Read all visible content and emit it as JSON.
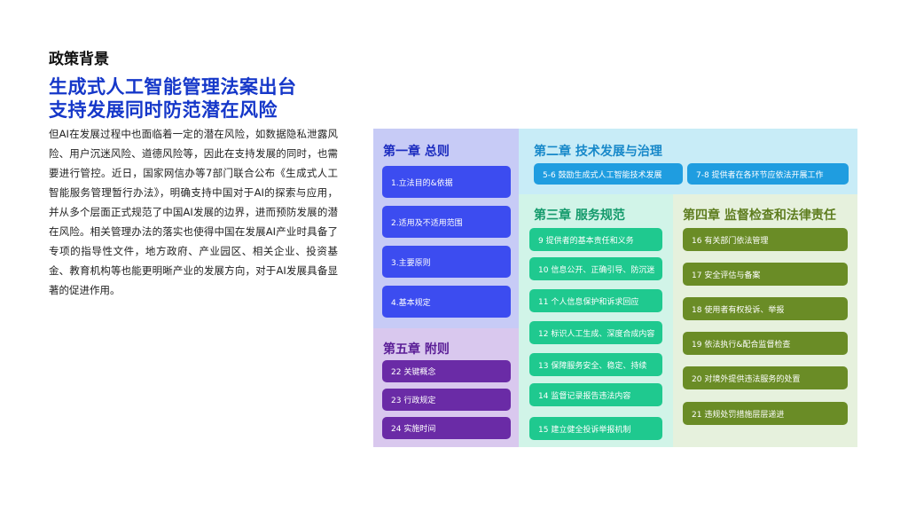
{
  "section_label": "政策背景",
  "headline": [
    "生成式人工智能管理法案出台",
    "支持发展同时防范潜在风险"
  ],
  "body": "但AI在发展过程中也面临着一定的潜在风险，如数据隐私泄露风险、用户沉迷风险、道德风险等，因此在支持发展的同时，也需要进行管控。近日，国家网信办等7部门联合公布《生成式人工智能服务管理暂行办法》，明确支持中国对于AI的探索与应用，并从多个层面正式规范了中国AI发展的边界，进而预防发展的潜在风险。相关管理办法的落实也使得中国在发展AI产业时具备了专项的指导性文件，地方政府、产业园区、相关企业、投资基金、教育机构等也能更明晰产业的发展方向，对于AI发展具备显著的促进作用。",
  "colors": {
    "headline": "#1537c9",
    "chapter1": "#3c4cf0",
    "chapter2": "#1f9de0",
    "chapter3": "#1fc98f",
    "chapter4": "#6a8c26",
    "chapter5": "#6a2ba6"
  },
  "chapters": {
    "ch1": {
      "title": "第一章 总则",
      "items": [
        "1.立法目的&依据",
        "2.适用及不适用范围",
        "3.主要原则",
        "4.基本规定"
      ]
    },
    "ch2": {
      "title": "第二章 技术发展与治理",
      "items": [
        "5-6 鼓励生成式人工智能技术发展",
        "7-8 提供者在各环节应依法开展工作"
      ]
    },
    "ch3": {
      "title": "第三章 服务规范",
      "items": [
        "9 提供者的基本责任和义务",
        "10 信息公开、正确引导、防沉迷",
        "11 个人信息保护和诉求回应",
        "12 标识人工生成、深度合成内容",
        "13 保障服务安全、稳定、持续",
        "14 监督记录报告违法内容",
        "15 建立健全投诉举报机制"
      ]
    },
    "ch4": {
      "title": "第四章 监督检查和法律责任",
      "items": [
        "16 有关部门依法管理",
        "17 安全评估与备案",
        "18 使用者有权投诉、举报",
        "19 依法执行&配合监督检查",
        "20 对境外提供违法服务的处置",
        "21 违规处罚措施层层递进"
      ]
    },
    "ch5": {
      "title": "第五章 附则",
      "items": [
        "22 关键概念",
        "23 行政规定",
        "24 实施时间"
      ]
    }
  }
}
